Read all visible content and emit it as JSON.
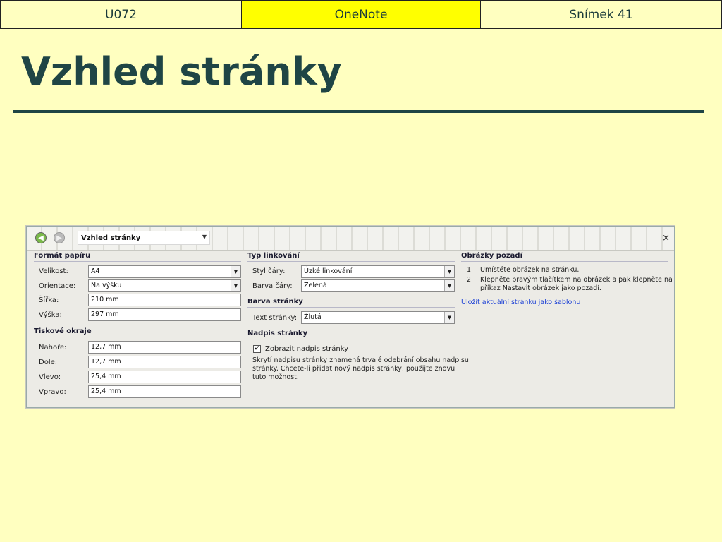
{
  "slide_header": {
    "left": "U072",
    "center": "OneNote",
    "right": "Snímek 41"
  },
  "slide_title": "Vzhled stránky",
  "colors": {
    "background": "#ffffc0",
    "header_center": "#ffff00",
    "title": "#1f4545",
    "link": "#1a3fd6"
  },
  "dialog": {
    "toolbar": {
      "back_icon": "back-arrow-icon",
      "forward_icon": "forward-arrow-icon",
      "title": "Vzhled stránky",
      "close": "×"
    },
    "paper_format": {
      "heading": "Formát papíru",
      "size_label": "Velikost:",
      "size_value": "A4",
      "orientation_label": "Orientace:",
      "orientation_value": "Na výšku",
      "width_label": "Šířka:",
      "width_value": "210 mm",
      "height_label": "Výška:",
      "height_value": "297 mm"
    },
    "print_margins": {
      "heading": "Tiskové okraje",
      "top_label": "Nahoře:",
      "top_value": "12,7 mm",
      "bottom_label": "Dole:",
      "bottom_value": "12,7 mm",
      "left_label": "Vlevo:",
      "left_value": "25,4 mm",
      "right_label": "Vpravo:",
      "right_value": "25,4 mm"
    },
    "rule_type": {
      "heading": "Typ linkování",
      "style_label": "Styl čáry:",
      "style_value": "Úzké linkování",
      "color_label": "Barva čáry:",
      "color_value": "Zelená"
    },
    "page_color": {
      "heading": "Barva stránky",
      "text_label": "Text stránky:",
      "text_value": "Žlutá"
    },
    "page_title": {
      "heading": "Nadpis stránky",
      "checkbox_label": "Zobrazit nadpis stránky",
      "checkbox_checked": true,
      "note_line1": "Skrytí nadpisu stránky znamená trvalé odebrání obsahu nadpisu",
      "note_line2": "stránky. Chcete-li přidat nový nadpis stránky, použijte znovu",
      "note_line3": "tuto možnost."
    },
    "background_images": {
      "heading": "Obrázky pozadí",
      "step1_num": "1.",
      "step1": "Umístěte obrázek na stránku.",
      "step2_num": "2.",
      "step2_line1": "Klepněte pravým tlačítkem na obrázek a pak klepněte na",
      "step2_line2": "příkaz Nastavit obrázek jako pozadí.",
      "save_template_link": "Uložit aktuální stránku jako šablonu"
    }
  }
}
